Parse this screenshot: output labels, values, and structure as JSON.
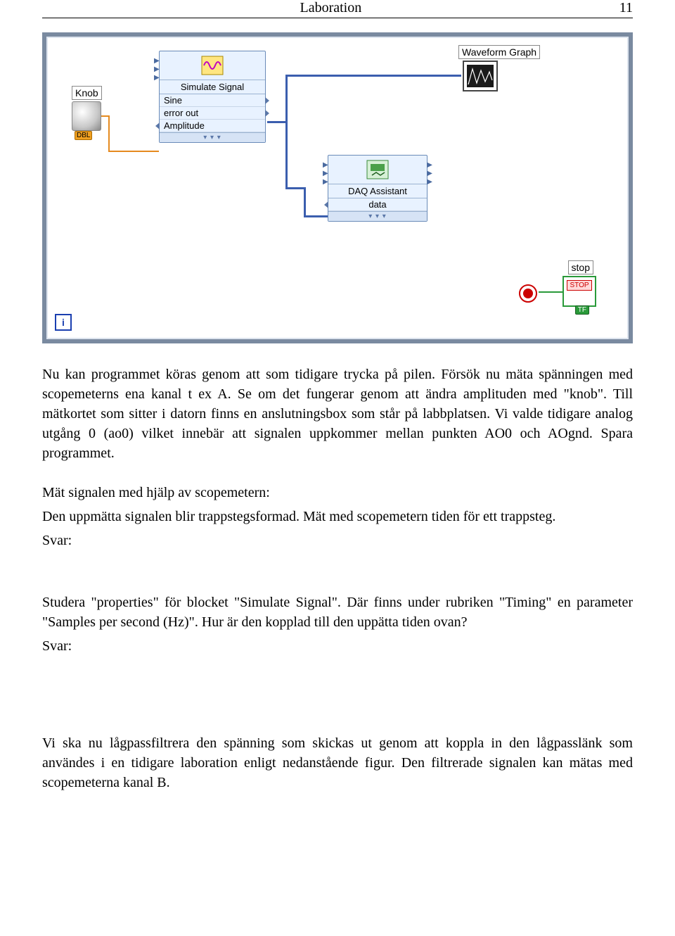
{
  "header": {
    "title": "Laboration",
    "page_number": "11"
  },
  "diagram": {
    "knob_label": "Knob",
    "knob_dbl": "DBL",
    "simulate": {
      "title": "Simulate Signal",
      "rows": [
        "Sine",
        "error out",
        "Amplitude"
      ]
    },
    "daq": {
      "title": "DAQ Assistant",
      "rows": [
        "data"
      ]
    },
    "graph_label": "Waveform Graph",
    "stop_label": "stop",
    "stop_button_text": "STOP",
    "stop_tf": "TF",
    "loop_i": "i"
  },
  "paragraphs": {
    "p1": "Nu kan programmet köras genom att som tidigare trycka på pilen. Försök nu mäta spänningen med scopemeterns ena kanal t ex A. Se om det fungerar genom att ändra amplituden med \"knob\". Till mätkortet som sitter i datorn finns en anslutningsbox som står på labbplatsen.  Vi valde tidigare analog utgång 0 (ao0) vilket innebär att signalen uppkommer mellan punkten AO0 och AOgnd. Spara programmet.",
    "p2_heading": "Mät signalen med hjälp av scopemetern:",
    "p2_body": "Den uppmätta signalen blir trappstegsformad. Mät med scopemetern tiden för ett trappsteg.",
    "svar_label": "Svar:",
    "p3": "Studera \"properties\" för blocket \"Simulate Signal\". Där finns under rubriken \"Timing\" en parameter \"Samples per second (Hz)\". Hur är den kopplad till den uppätta tiden ovan?",
    "p4": "Vi ska nu lågpassfiltrera den spänning som skickas ut genom att koppla in den lågpasslänk som användes i en tidigare laboration enligt nedanstående figur. Den filtrerade signalen kan mätas med scopemeterna kanal B."
  }
}
